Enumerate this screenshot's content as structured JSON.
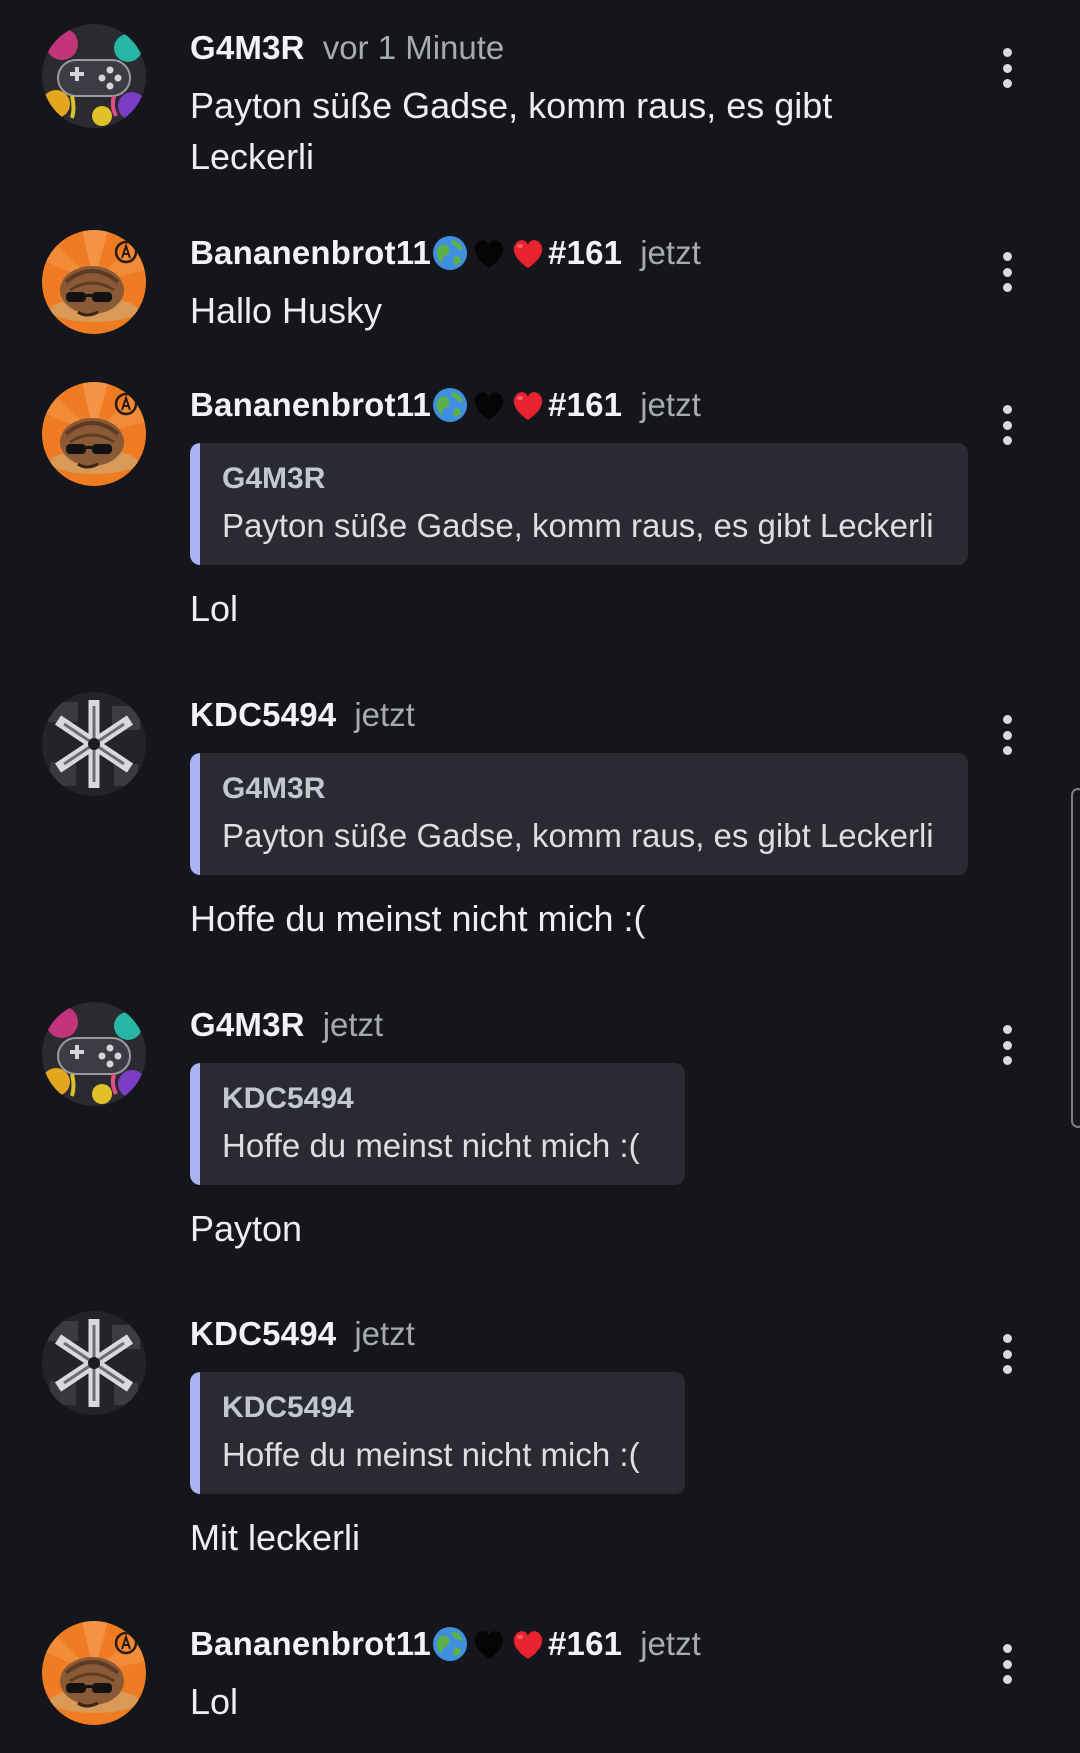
{
  "messages": [
    {
      "username": "G4M3R",
      "avatar": "controller-avatar",
      "timestamp": "vor 1 Minute",
      "text": "Payton süße Gadse, komm raus, es gibt Leckerli"
    },
    {
      "username": "Bananenbrot11",
      "user_suffix": "#161",
      "avatar": "sloth-sunglasses-avatar",
      "emojis": [
        "globe-emoji",
        "black-heart-emoji",
        "red-heart-emoji"
      ],
      "timestamp": "jetzt",
      "text": "Hallo Husky"
    },
    {
      "username": "Bananenbrot11",
      "user_suffix": "#161",
      "avatar": "sloth-sunglasses-avatar",
      "emojis": [
        "globe-emoji",
        "black-heart-emoji",
        "red-heart-emoji"
      ],
      "timestamp": "jetzt",
      "quote": {
        "author": "G4M3R",
        "text": "Payton süße Gadse, komm raus, es gibt Leckerli"
      },
      "text": "Lol"
    },
    {
      "username": "KDC5494",
      "avatar": "star-collage-avatar",
      "timestamp": "jetzt",
      "quote": {
        "author": "G4M3R",
        "text": "Payton süße Gadse, komm raus, es gibt Leckerli"
      },
      "text": "Hoffe du meinst nicht mich :("
    },
    {
      "username": "G4M3R",
      "avatar": "controller-avatar",
      "timestamp": "jetzt",
      "quote": {
        "author": "KDC5494",
        "text": "Hoffe du meinst nicht mich :("
      },
      "text": "Payton"
    },
    {
      "username": "KDC5494",
      "avatar": "star-collage-avatar",
      "timestamp": "jetzt",
      "quote": {
        "author": "KDC5494",
        "text": "Hoffe du meinst nicht mich :("
      },
      "text": "Mit leckerli"
    },
    {
      "username": "Bananenbrot11",
      "user_suffix": "#161",
      "avatar": "sloth-sunglasses-avatar",
      "emojis": [
        "globe-emoji",
        "black-heart-emoji",
        "red-heart-emoji"
      ],
      "timestamp": "jetzt",
      "text": "Lol"
    }
  ],
  "colors": {
    "background": "#15161b",
    "quote_background": "#2a2b32",
    "quote_bar": "#a9b4f5",
    "timestamp": "#a8aab3"
  }
}
